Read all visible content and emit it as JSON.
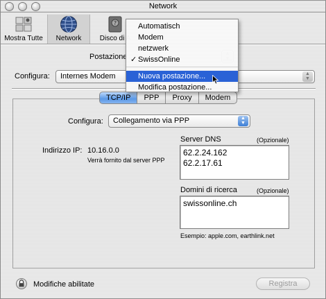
{
  "window": {
    "title": "Network"
  },
  "toolbar": {
    "items": [
      {
        "label": "Mostra Tutte",
        "icon": "show-all-icon"
      },
      {
        "label": "Network",
        "icon": "network-globe-icon"
      },
      {
        "label": "Disco di A",
        "icon": "startup-disk-icon"
      }
    ]
  },
  "location": {
    "label": "Postazione"
  },
  "config_top": {
    "label": "Configura:",
    "value": "Internes Modem"
  },
  "location_menu": {
    "items": [
      "Automatisch",
      "Modem",
      "netzwerk",
      "SwissOnline"
    ],
    "checked": "SwissOnline",
    "actions": [
      "Nuova postazione...",
      "Modifica postazione..."
    ],
    "highlighted": "Nuova postazione..."
  },
  "tabs": [
    "TCP/IP",
    "PPP",
    "Proxy",
    "Modem"
  ],
  "active_tab": "TCP/IP",
  "tcpip": {
    "config_label": "Configura:",
    "config_value": "Collegamento via PPP",
    "ip_label": "Indirizzo IP:",
    "ip_value": "10.16.0.0",
    "ip_note": "Verrà fornito dal server PPP",
    "dns_label": "Server DNS",
    "dns_optional": "(Opzionale)",
    "dns_servers": [
      "62.2.24.162",
      "62.2.17.61"
    ],
    "search_label": "Domini di ricerca",
    "search_optional": "(Opzionale)",
    "search_domains": [
      "swissonline.ch"
    ],
    "example": "Esempio: apple.com, earthlink.net"
  },
  "footer": {
    "lock_text": "Modifiche abilitate",
    "apply_label": "Registra"
  },
  "colors": {
    "accent": "#2a62d6",
    "tab_active": "#5b98e6",
    "popup_arrow": "#3d7fd6"
  }
}
